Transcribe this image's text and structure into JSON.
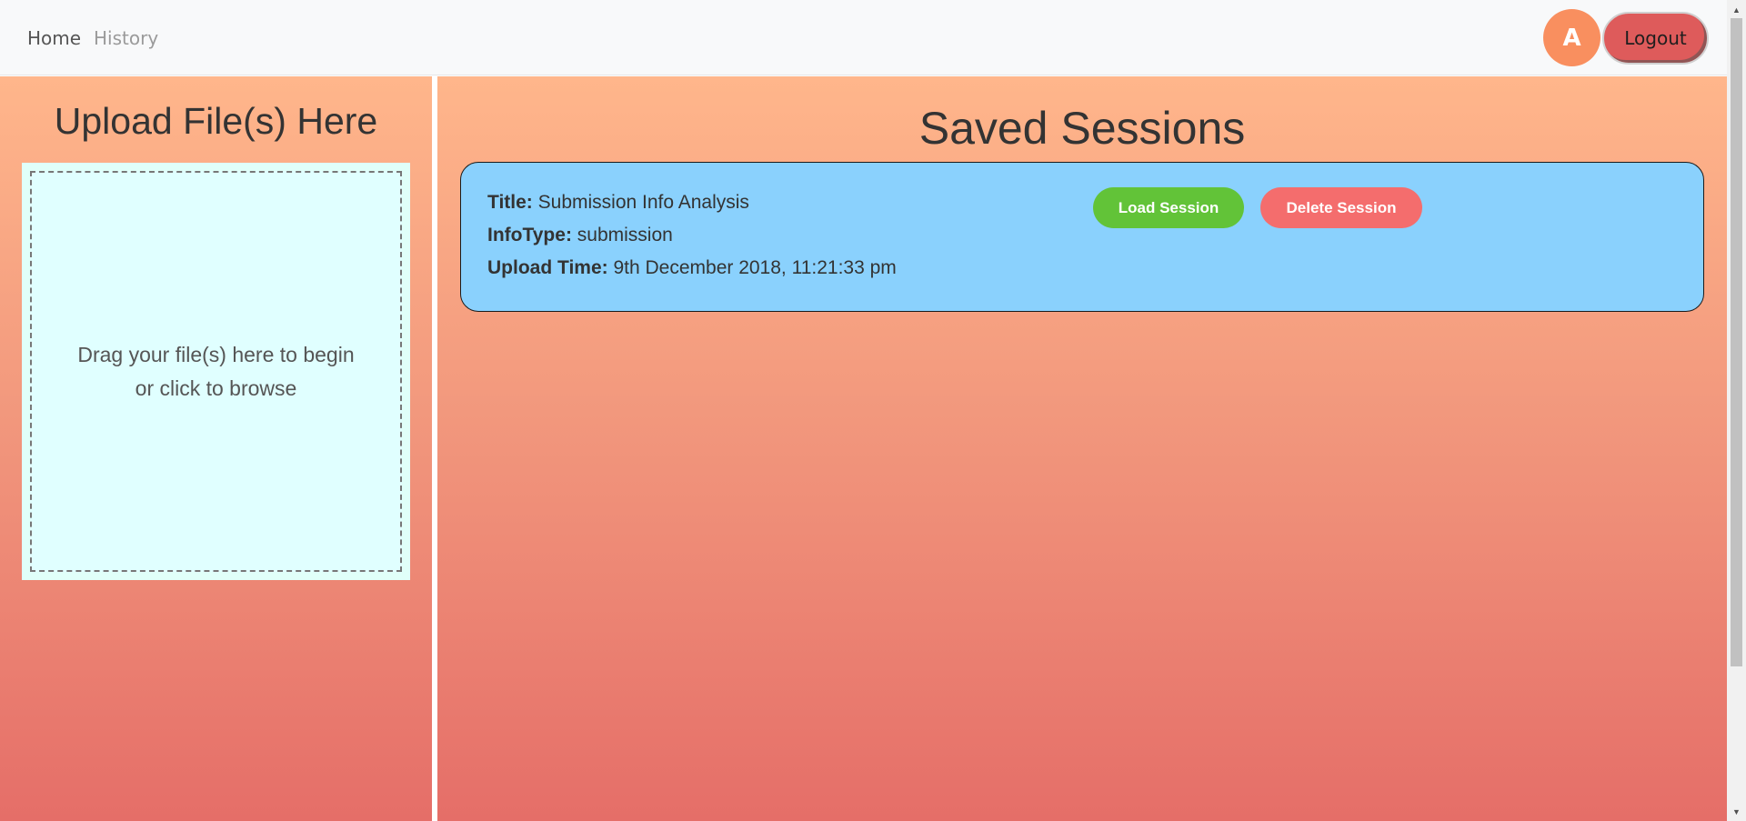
{
  "nav": {
    "home_label": "Home",
    "history_label": "History",
    "avatar_initial": "A",
    "logout_label": "Logout"
  },
  "upload": {
    "title": "Upload File(s) Here",
    "drop_line1": "Drag your file(s) here to begin",
    "drop_line2": "or click to browse"
  },
  "sessions": {
    "title": "Saved Sessions",
    "items": [
      {
        "title_label": "Title:",
        "title_value": "Submission Info Analysis",
        "infotype_label": "InfoType:",
        "infotype_value": "submission",
        "upload_time_label": "Upload Time:",
        "upload_time_value": "9th December 2018, 11:21:33 pm",
        "load_label": "Load Session",
        "delete_label": "Delete Session"
      }
    ]
  },
  "colors": {
    "load_button": "#62c338",
    "delete_button": "#f46d6d",
    "card_background": "#8ad1fd",
    "avatar": "#f98f5f",
    "logout": "#de5b5b"
  },
  "icons": {
    "scroll_up": "triangle-up",
    "scroll_down": "triangle-down"
  }
}
